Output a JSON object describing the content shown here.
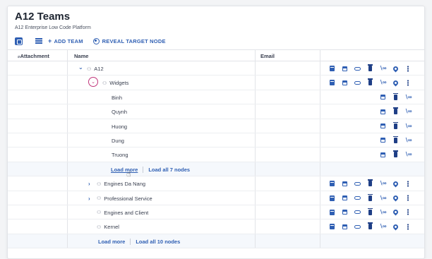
{
  "header": {
    "title": "A12 Teams",
    "subtitle": "A12 Enterprise Low Code Platform"
  },
  "toolbar": {
    "add_team_label": "ADD TEAM",
    "reveal_label": "REVEAL TARGET NODE"
  },
  "columns": {
    "attachment": "Attachment",
    "name": "Name",
    "email": "Email"
  },
  "rows": [
    {
      "name": "A12",
      "expanded": true,
      "level": 1
    },
    {
      "name": "Widgets",
      "expanded": true,
      "level": 2
    },
    {
      "name": "Binh",
      "level": 3
    },
    {
      "name": "Quynh",
      "level": 3
    },
    {
      "name": "Huong",
      "level": 3
    },
    {
      "name": "Dung",
      "level": 3
    },
    {
      "name": "Truong",
      "level": 3
    },
    {
      "name": "Engines Da Nang",
      "expanded": false,
      "level": 2
    },
    {
      "name": "Professional Service",
      "expanded": false,
      "level": 2
    },
    {
      "name": "Engines and Client",
      "level": 2
    },
    {
      "name": "Kernel",
      "level": 2
    }
  ],
  "load_inner": {
    "more": "Load more",
    "all": "Load all 7 nodes"
  },
  "load_outer": {
    "more": "Load more",
    "all": "Load all 10 nodes"
  },
  "icons": {
    "expand": "chevron-down-icon",
    "collapse": "chevron-right-icon",
    "team": "team-icon"
  }
}
